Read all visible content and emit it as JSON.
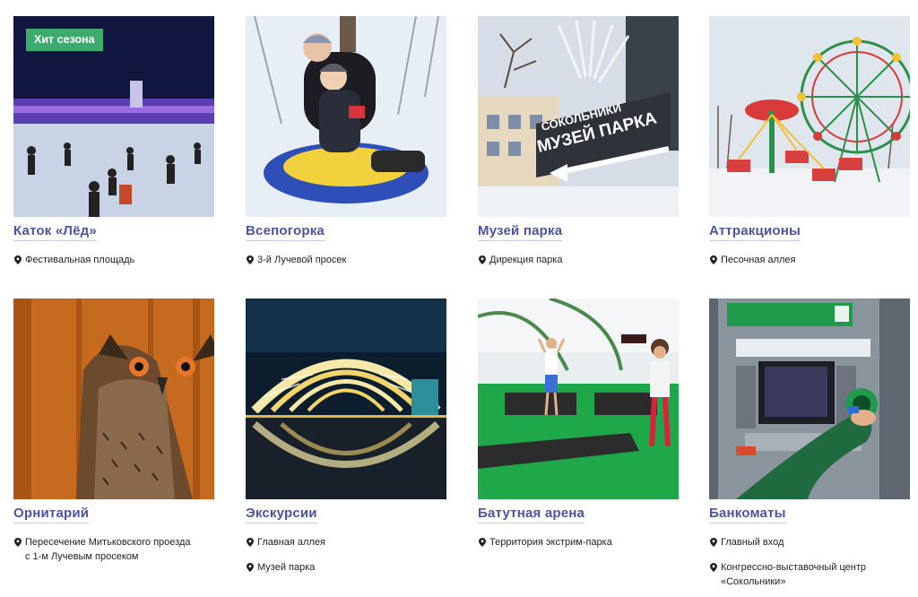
{
  "colors": {
    "title": "#4a54a3",
    "badge": "#3daa6e",
    "text": "#222222"
  },
  "cards": [
    {
      "title": "Каток «Лёд»",
      "badge": "Хит сезона",
      "image": "skating-rink-photo",
      "locations": [
        "Фестивальная площадь"
      ]
    },
    {
      "title": "Всепогорка",
      "image": "snow-tubing-photo",
      "locations": [
        "3-й Лучевой просек"
      ]
    },
    {
      "title": "Музей парка",
      "image": "park-museum-photo",
      "locations": [
        "Дирекция парка"
      ]
    },
    {
      "title": "Аттракционы",
      "image": "ferris-wheel-photo",
      "locations": [
        "Песочная аллея"
      ]
    },
    {
      "title": "Орнитарий",
      "image": "owl-photo",
      "locations": [
        "Пересечение Митьковского проезда\nс 1-м Лучевым просеком"
      ]
    },
    {
      "title": "Экскурсии",
      "image": "light-tunnel-photo",
      "locations": [
        "Главная аллея",
        "Музей парка"
      ]
    },
    {
      "title": "Батутная арена",
      "image": "trampoline-arena-photo",
      "locations": [
        "Территория экстрим-парка"
      ]
    },
    {
      "title": "Банкоматы",
      "image": "atm-photo",
      "locations": [
        "Главный вход",
        "Конгрессно-выставочный центр\n«Сокольники»"
      ]
    }
  ],
  "museum_sign": {
    "line1": "СОКОЛЬНИКИ",
    "line2": "МУЗЕЙ ПАРКА"
  }
}
